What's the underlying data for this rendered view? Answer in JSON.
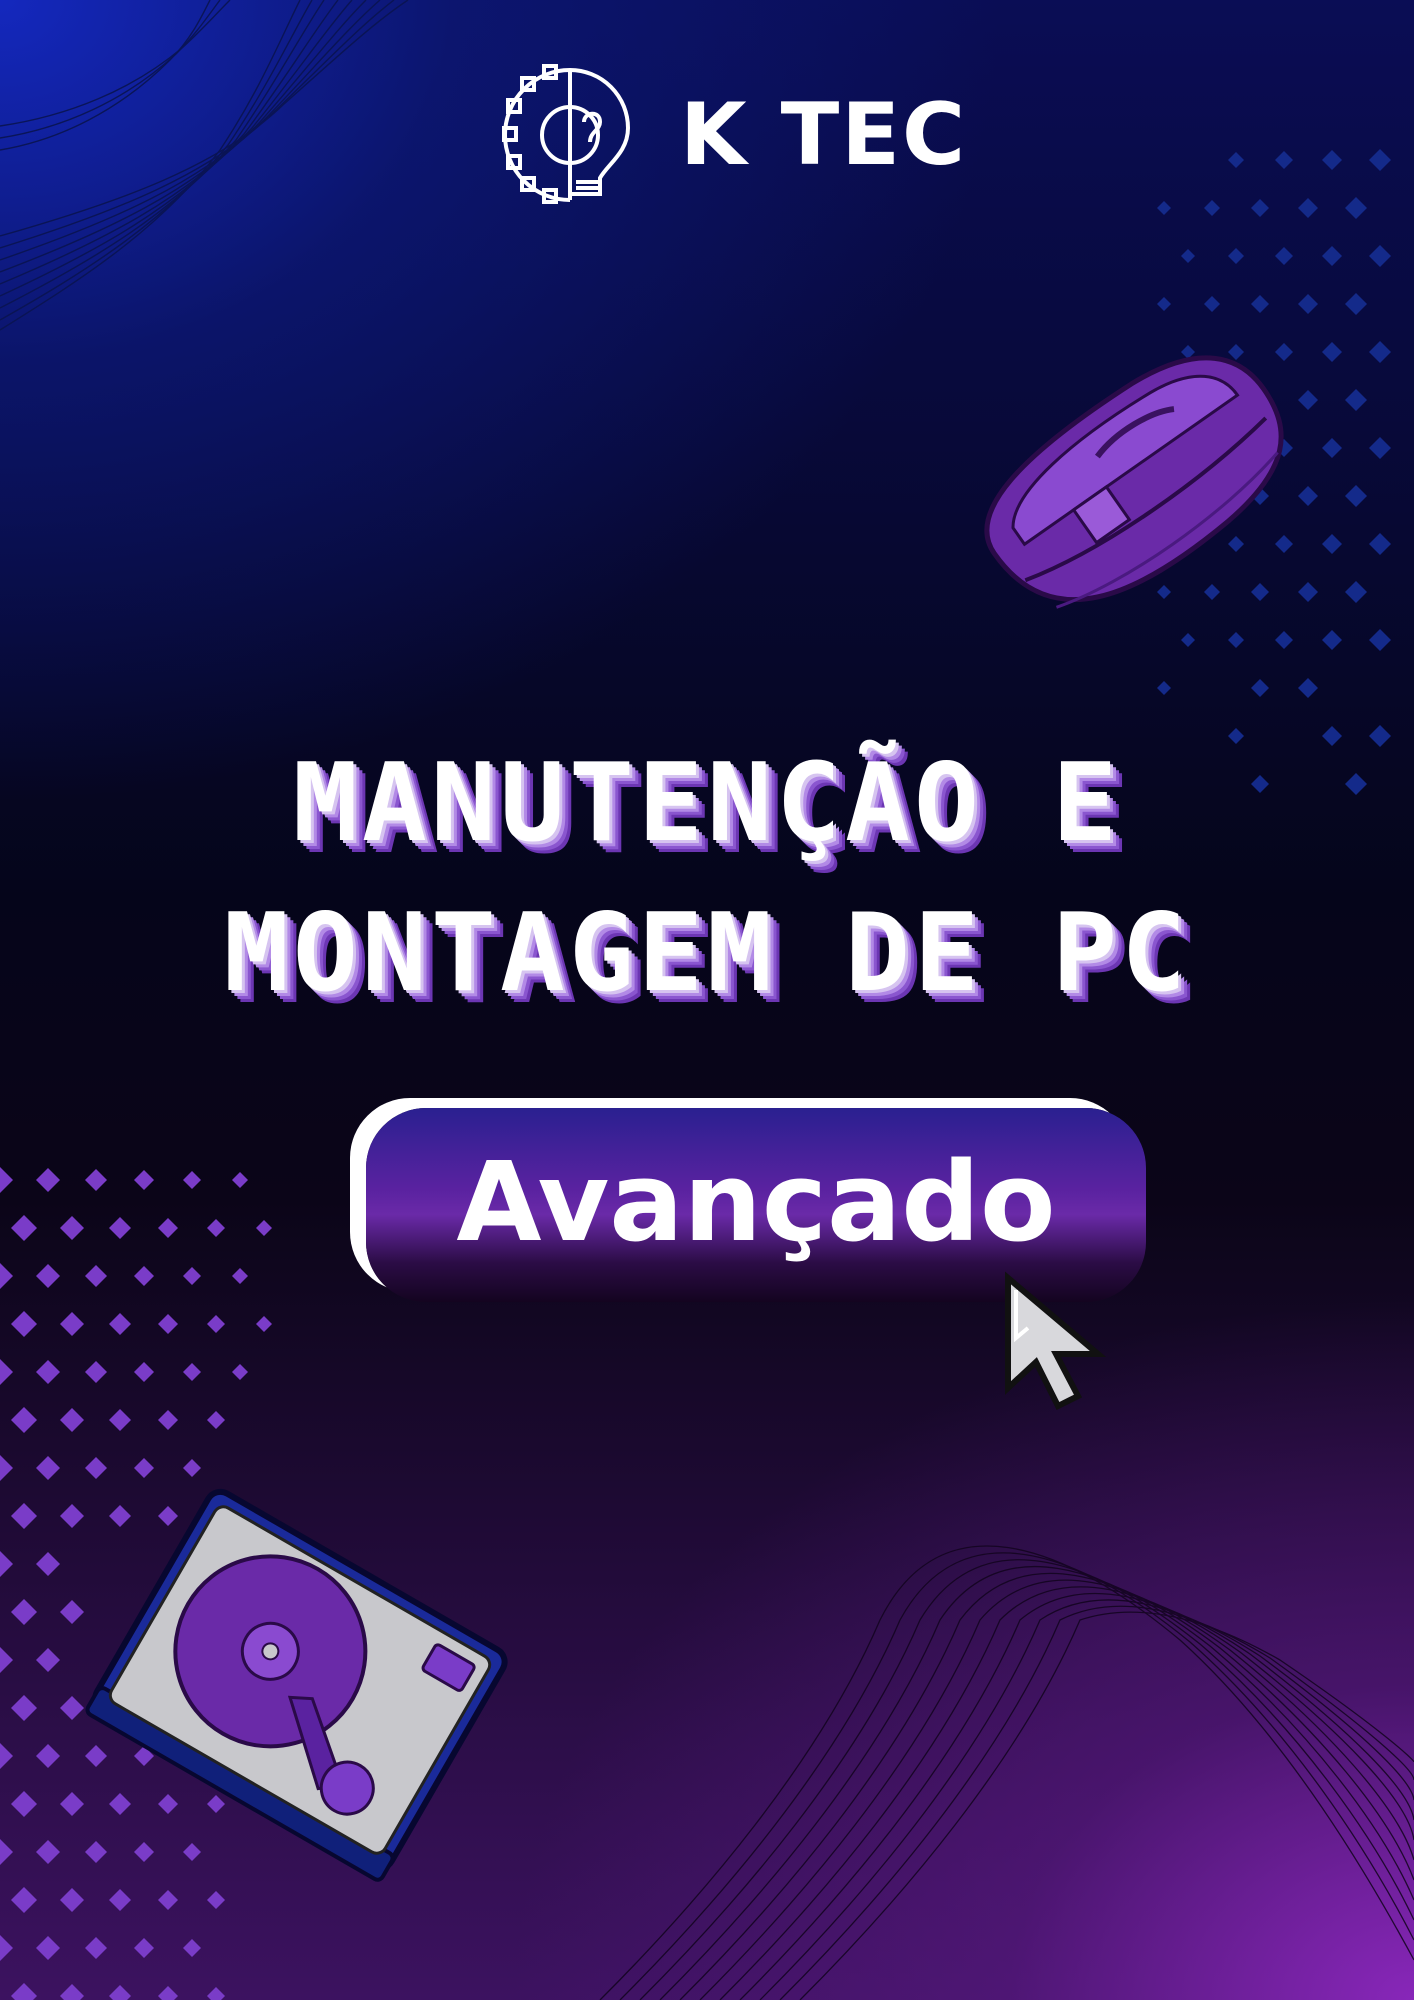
{
  "brand": {
    "name": "K TEC",
    "logo_icon": "gear-lightbulb-logo"
  },
  "title": {
    "line1": "MANUTENÇÃO E",
    "line2": "MONTAGEM DE PC"
  },
  "level_button": {
    "label": "Avançado"
  },
  "decorations": {
    "cursor_icon": "mouse-pointer-icon",
    "mouse_illustration": "gaming-mouse",
    "drive_illustration": "hard-disk-drive"
  },
  "colors": {
    "accent_purple": "#7a2fb8",
    "accent_blue": "#1a2aa8",
    "dots_blue": "#142a8a",
    "dots_purple": "#7a3cc8"
  }
}
